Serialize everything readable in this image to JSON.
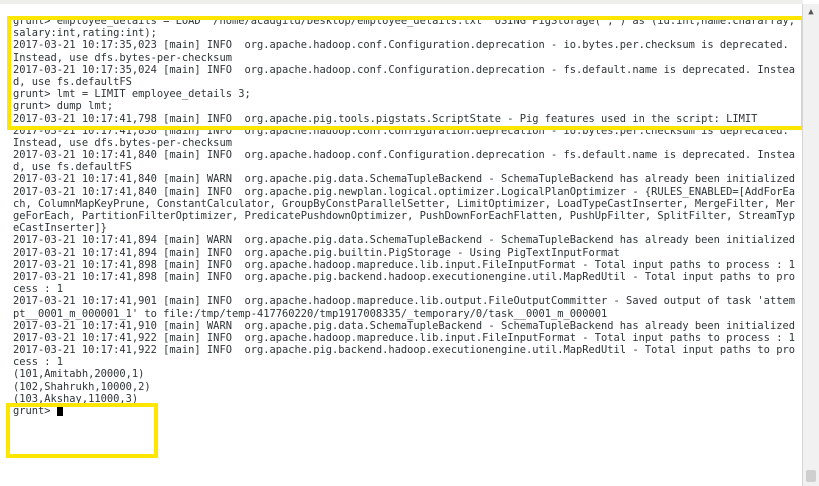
{
  "terminal": {
    "lines": [
      "grunt> employee_details = LOAD '/home/acadgild/Desktop/employee_details.txt' USING PigStorage(',') as (id:int,name:chararray,",
      "salary:int,rating:int);",
      "2017-03-21 10:17:35,023 [main] INFO  org.apache.hadoop.conf.Configuration.deprecation - io.bytes.per.checksum is deprecated.",
      "Instead, use dfs.bytes-per-checksum",
      "2017-03-21 10:17:35,024 [main] INFO  org.apache.hadoop.conf.Configuration.deprecation - fs.default.name is deprecated. Instea",
      "d, use fs.defaultFS",
      "grunt> lmt = LIMIT employee_details 3;",
      "grunt> dump lmt;",
      "2017-03-21 10:17:41,798 [main] INFO  org.apache.pig.tools.pigstats.ScriptState - Pig features used in the script: LIMIT",
      "2017-03-21 10:17:41,838 [main] INFO  org.apache.hadoop.conf.Configuration.deprecation - io.bytes.per.checksum is deprecated.",
      "Instead, use dfs.bytes-per-checksum",
      "2017-03-21 10:17:41,840 [main] INFO  org.apache.hadoop.conf.Configuration.deprecation - fs.default.name is deprecated. Instea",
      "d, use fs.defaultFS",
      "2017-03-21 10:17:41,840 [main] WARN  org.apache.pig.data.SchemaTupleBackend - SchemaTupleBackend has already been initialized",
      "2017-03-21 10:17:41,840 [main] INFO  org.apache.pig.newplan.logical.optimizer.LogicalPlanOptimizer - {RULES_ENABLED=[AddForEa",
      "ch, ColumnMapKeyPrune, ConstantCalculator, GroupByConstParallelSetter, LimitOptimizer, LoadTypeCastInserter, MergeFilter, Mer",
      "geForEach, PartitionFilterOptimizer, PredicatePushdownOptimizer, PushDownForEachFlatten, PushUpFilter, SplitFilter, StreamTyp",
      "eCastInserter]}",
      "2017-03-21 10:17:41,894 [main] WARN  org.apache.pig.data.SchemaTupleBackend - SchemaTupleBackend has already been initialized",
      "2017-03-21 10:17:41,894 [main] INFO  org.apache.pig.builtin.PigStorage - Using PigTextInputFormat",
      "2017-03-21 10:17:41,898 [main] INFO  org.apache.hadoop.mapreduce.lib.input.FileInputFormat - Total input paths to process : 1",
      "2017-03-21 10:17:41,898 [main] INFO  org.apache.pig.backend.hadoop.executionengine.util.MapRedUtil - Total input paths to pro",
      "cess : 1",
      "2017-03-21 10:17:41,901 [main] INFO  org.apache.hadoop.mapreduce.lib.output.FileOutputCommitter - Saved output of task 'attem",
      "pt__0001_m_000001_1' to file:/tmp/temp-417760220/tmp1917008335/_temporary/0/task__0001_m_000001",
      "2017-03-21 10:17:41,910 [main] WARN  org.apache.pig.data.SchemaTupleBackend - SchemaTupleBackend has already been initialized",
      "2017-03-21 10:17:41,922 [main] INFO  org.apache.hadoop.mapreduce.lib.input.FileInputFormat - Total input paths to process : 1",
      "2017-03-21 10:17:41,922 [main] INFO  org.apache.pig.backend.hadoop.executionengine.util.MapRedUtil - Total input paths to pro",
      "cess : 1",
      "(101,Amitabh,20000,1)",
      "(102,Shahrukh,10000,2)",
      "(103,Akshay,11000,3)",
      "grunt> "
    ]
  },
  "scrollbar": {
    "up_arrow_icon": "up-triangle"
  },
  "colors": {
    "highlight": "#ffe600",
    "text": "#2e3436",
    "background": "#ffffff"
  }
}
